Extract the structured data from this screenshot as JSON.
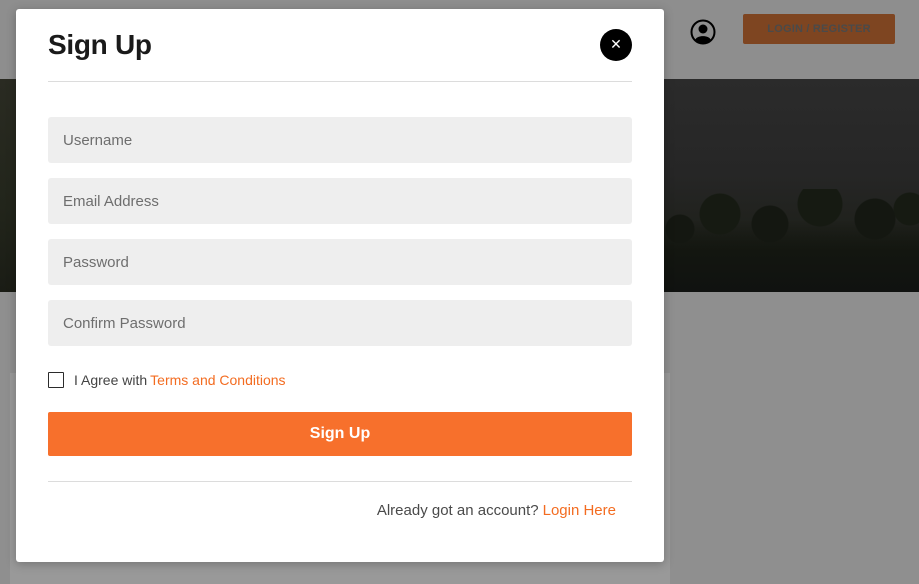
{
  "background": {
    "header": {
      "login_register_label": "LOGIN / REGISTER",
      "user_icon": "user-circle-icon"
    }
  },
  "modal": {
    "title": "Sign Up",
    "close_icon": "close-icon",
    "close_glyph": "✕",
    "fields": {
      "username_placeholder": "Username",
      "email_placeholder": "Email Address",
      "password_placeholder": "Password",
      "confirm_password_placeholder": "Confirm Password"
    },
    "agree": {
      "checked": false,
      "text": "I Agree with",
      "terms_link": "Terms and Conditions"
    },
    "submit_label": "Sign Up",
    "footer": {
      "prompt": "Already got an account?",
      "login_link": "Login Here"
    }
  },
  "colors": {
    "accent": "#f7702c",
    "link": "#f36c21",
    "field_bg": "#eeeeee",
    "overlay": "#8f8f8f"
  }
}
